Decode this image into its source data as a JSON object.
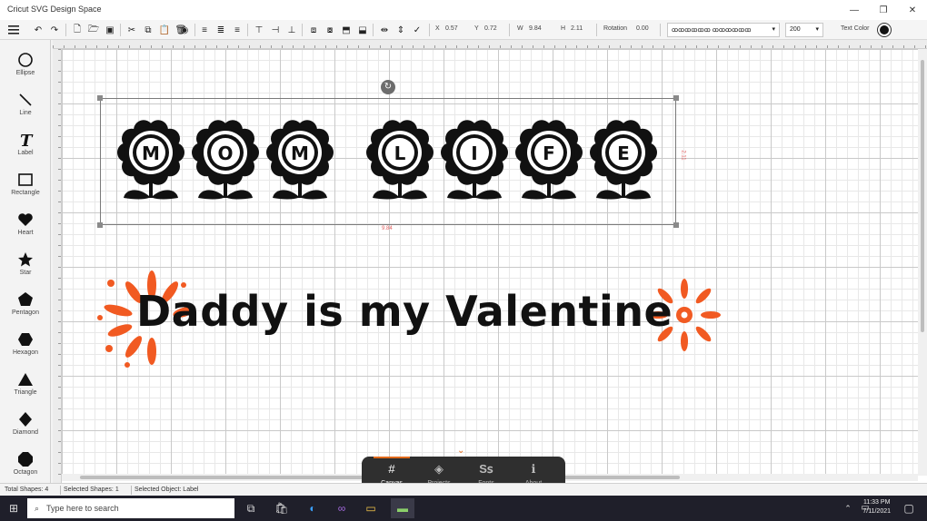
{
  "app": {
    "title": "Cricut SVG Design Space"
  },
  "window": {
    "minimize": "—",
    "restore": "❐",
    "close": "✕"
  },
  "toolbar": {
    "x_label": "X",
    "x_value": "0.57",
    "y_label": "Y",
    "y_value": "0.72",
    "w_label": "W",
    "w_value": "9.84",
    "h_label": "H",
    "h_value": "2.11",
    "rotation_label": "Rotation",
    "rotation_value": "0.00",
    "font_value": "ꝏꝏꝏꝏꝏꝏ ꝏꝏꝏꝏꝏꝏ",
    "font_size": "200",
    "text_color_label": "Text Color"
  },
  "tools": [
    {
      "label": "Ellipse",
      "icon": "ellipse-icon"
    },
    {
      "label": "Line",
      "icon": "line-icon"
    },
    {
      "label": "Label",
      "icon": "label-icon"
    },
    {
      "label": "Rectangle",
      "icon": "rectangle-icon"
    },
    {
      "label": "Heart",
      "icon": "heart-icon"
    },
    {
      "label": "Star",
      "icon": "star-icon"
    },
    {
      "label": "Pentagon",
      "icon": "pentagon-icon"
    },
    {
      "label": "Hexagon",
      "icon": "hexagon-icon"
    },
    {
      "label": "Triangle",
      "icon": "triangle-icon"
    },
    {
      "label": "Diamond",
      "icon": "diamond-icon"
    },
    {
      "label": "Octagon",
      "icon": "octagon-icon"
    }
  ],
  "canvas": {
    "flower_letters": [
      "M",
      "O",
      "M",
      "L",
      "I",
      "F",
      "E"
    ],
    "selection_width": "9.84",
    "selection_height": "2.11",
    "valentine_text": "Daddy is my Valentine",
    "accent_color": "#f15a22"
  },
  "status": {
    "total_shapes": "Total Shapes: 4",
    "selected_shapes": "Selected Shapes: 1",
    "selected_object": "Selected Object: Label"
  },
  "bottom_panel": [
    {
      "label": "Canvas",
      "icon": "canvas-icon",
      "active": true
    },
    {
      "label": "Projects",
      "icon": "layers-icon",
      "active": false
    },
    {
      "label": "Fonts",
      "icon": "fonts-icon",
      "active": false
    },
    {
      "label": "About",
      "icon": "about-icon",
      "active": false
    }
  ],
  "taskbar": {
    "search_placeholder": "Type here to search",
    "time": "11:33 PM",
    "date": "7/11/2021"
  }
}
